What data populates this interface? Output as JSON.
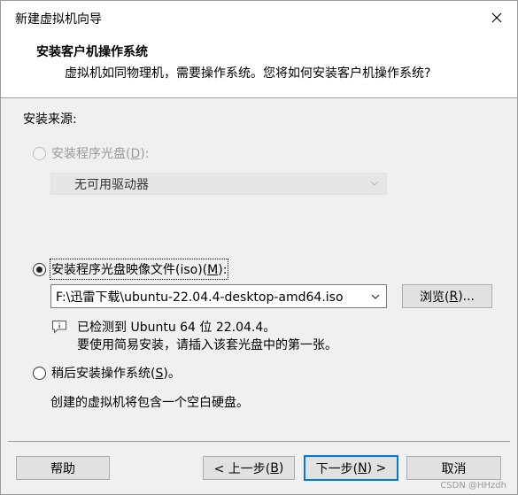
{
  "window": {
    "title": "新建虚拟机向导"
  },
  "header": {
    "title": "安装客户机操作系统",
    "subtitle": "虚拟机如同物理机，需要操作系统。您将如何安装客户机操作系统?"
  },
  "source": {
    "label": "安装来源:",
    "disc_option": {
      "text": "安装程序光盘(",
      "key": "D",
      "suffix": "):",
      "selected": false,
      "enabled": false
    },
    "disc_drive_select": {
      "value": "无可用驱动器",
      "enabled": false
    },
    "iso_option": {
      "text": "安装程序光盘映像文件(iso)(",
      "key": "M",
      "suffix": "):",
      "selected": true
    },
    "iso_path": {
      "value": "F:\\迅雷下载\\ubuntu-22.04.4-desktop-amd64.iso"
    },
    "browse_button": {
      "text": "浏览(",
      "key": "R",
      "suffix": ")..."
    },
    "detect_info": {
      "line1": "已检测到 Ubuntu 64 位 22.04.4。",
      "line2": "要使用简易安装，请插入该套光盘中的第一张。"
    },
    "later_option": {
      "text": "稍后安装操作系统(",
      "key": "S",
      "suffix": ")。",
      "selected": false
    },
    "later_desc": "创建的虚拟机将包含一个空白硬盘。"
  },
  "footer": {
    "help": "帮助",
    "back": {
      "text": "< 上一步(",
      "key": "B",
      "suffix": ")"
    },
    "next": {
      "text": "下一步(",
      "key": "N",
      "suffix": ") >"
    },
    "cancel": "取消"
  },
  "watermark": "CSDN @HHzdh",
  "colors": {
    "accent": "#0078d7",
    "disabled_text": "#9a9a9a"
  },
  "icons": [
    "close-icon",
    "chevron-down-icon",
    "info-icon"
  ]
}
